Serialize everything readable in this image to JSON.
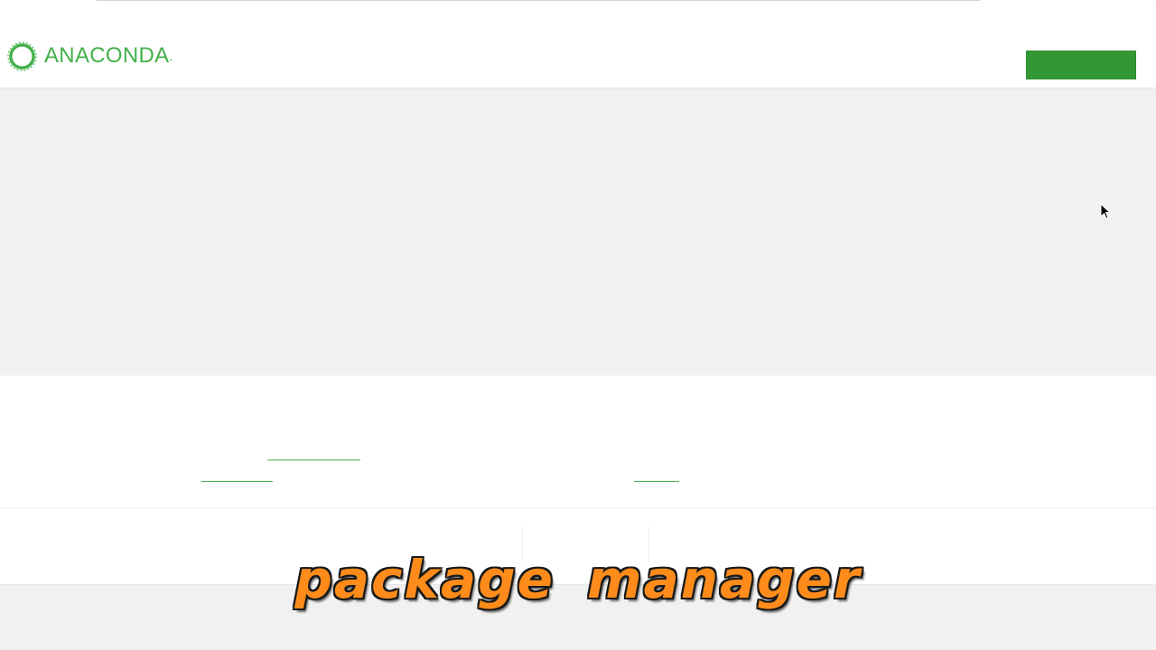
{
  "header": {
    "logo_text": "ANACONDA",
    "logo_mark": ".",
    "brand_color": "#43b049",
    "download_button_label": "",
    "download_button_color": "#349735"
  },
  "hero": {
    "background": "#f1f1f1"
  },
  "caption": {
    "text": "package manager",
    "color": "#ff8c1a"
  }
}
